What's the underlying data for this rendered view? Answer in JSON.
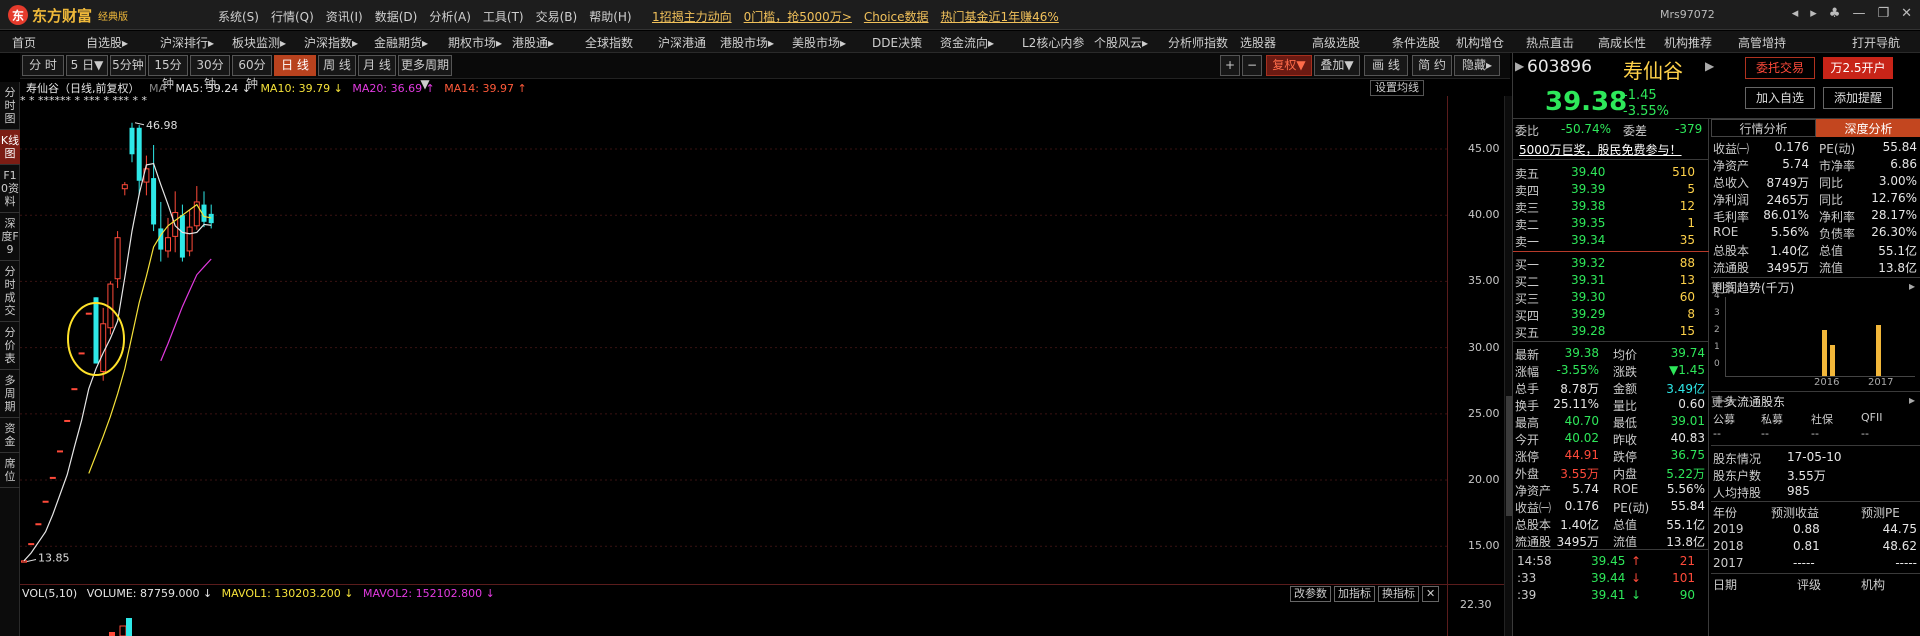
{
  "app": {
    "logo_name": "东方财富",
    "logo_edition": "经典版",
    "user": "Mrs97072"
  },
  "menu": [
    "系统(S)",
    "行情(Q)",
    "资讯(I)",
    "数据(D)",
    "分析(A)",
    "工具(T)",
    "交易(B)",
    "帮助(H)"
  ],
  "ads": [
    "1招揭主力动向",
    "0门槛，抢5000万>",
    "Choice数据",
    "热门基金近1年赚46%"
  ],
  "nav": [
    "首页",
    "自选股▸",
    "沪深排行▸",
    "板块监测▸",
    "沪深指数▸",
    "金融期货▸",
    "期权市场▸",
    "港股通▸",
    "全球指数",
    "沪深港通",
    "港股市场▸",
    "美股市场▸",
    "DDE决策",
    "资金流向▸",
    "L2核心内参",
    "个股风云▸",
    "分析师指数",
    "选股器",
    "高级选股",
    "条件选股",
    "机构增仓",
    "热点直击",
    "高成长性",
    "机构推荐",
    "高管增持",
    "打开导航"
  ],
  "left_tabs": [
    "分时图",
    "K线图",
    "F10资料",
    "深度F9",
    "分时成交",
    "分价表",
    "多周期",
    "资金",
    "席位"
  ],
  "toolbar_periods": [
    "分 时",
    "5 日▼",
    "5分钟",
    "15分钟",
    "30分钟",
    "60分钟",
    "日 线",
    "周 线",
    "月 线",
    "更多周期▼"
  ],
  "toolbar_right": [
    "+",
    "−",
    "复权▼",
    "叠加▼",
    "画 线",
    "简 约",
    "隐藏▸"
  ],
  "chart_header": {
    "name": "寿仙谷（日线,前复权）",
    "ma_label": "MA",
    "ma5": "MA5: 39.24 ↓",
    "ma10": "MA10: 39.79 ↓",
    "ma20": "MA20: 36.69 ↑",
    "ma14": "MA14: 39.97 ↑",
    "settings": "设置均线"
  },
  "stars": "*  *  ****** *  ***  *  ***  *  *",
  "chart_data": {
    "type": "candlestick",
    "ylim": [
      12,
      49
    ],
    "yticks": [
      "45.00",
      "40.00",
      "35.00",
      "30.00",
      "25.00",
      "20.00",
      "15.00"
    ],
    "annotations": [
      "46.98",
      "13.85"
    ],
    "candles": [
      {
        "o": 13.8,
        "c": 13.9,
        "h": 13.9,
        "l": 13.8
      },
      {
        "o": 15.2,
        "c": 15.2,
        "h": 15.2,
        "l": 15.2
      },
      {
        "o": 16.7,
        "c": 16.7,
        "h": 16.7,
        "l": 16.7
      },
      {
        "o": 18.4,
        "c": 18.4,
        "h": 18.4,
        "l": 18.4
      },
      {
        "o": 20.2,
        "c": 20.2,
        "h": 20.2,
        "l": 20.2
      },
      {
        "o": 22.2,
        "c": 22.2,
        "h": 22.2,
        "l": 22.2
      },
      {
        "o": 24.5,
        "c": 24.5,
        "h": 24.5,
        "l": 24.5
      },
      {
        "o": 26.9,
        "c": 26.9,
        "h": 26.9,
        "l": 26.9
      },
      {
        "o": 29.6,
        "c": 29.6,
        "h": 29.6,
        "l": 29.6
      },
      {
        "o": 32.6,
        "c": 32.6,
        "h": 32.6,
        "l": 32.6
      },
      {
        "o": 33.8,
        "c": 28.8,
        "h": 33.8,
        "l": 28.8
      },
      {
        "o": 28.2,
        "c": 31.8,
        "h": 33.0,
        "l": 27.5
      },
      {
        "o": 31.5,
        "c": 34.8,
        "h": 35.0,
        "l": 31.0
      },
      {
        "o": 35.2,
        "c": 38.3,
        "h": 38.8,
        "l": 34.5
      },
      {
        "o": 42.0,
        "c": 42.3,
        "h": 42.5,
        "l": 41.5
      },
      {
        "o": 46.6,
        "c": 44.6,
        "h": 46.98,
        "l": 44.0
      },
      {
        "o": 46.6,
        "c": 42.6,
        "h": 46.8,
        "l": 41.5
      },
      {
        "o": 42.5,
        "c": 43.5,
        "h": 44.5,
        "l": 41.5
      },
      {
        "o": 42.8,
        "c": 39.3,
        "h": 45.3,
        "l": 38.8
      },
      {
        "o": 39.0,
        "c": 37.4,
        "h": 41.0,
        "l": 36.5
      },
      {
        "o": 37.3,
        "c": 38.3,
        "h": 39.8,
        "l": 36.8
      },
      {
        "o": 38.4,
        "c": 40.2,
        "h": 41.8,
        "l": 37.2
      },
      {
        "o": 40.0,
        "c": 36.8,
        "h": 40.8,
        "l": 36.5
      },
      {
        "o": 37.3,
        "c": 39.1,
        "h": 40.4,
        "l": 36.9
      },
      {
        "o": 39.2,
        "c": 41.0,
        "h": 42.2,
        "l": 38.9
      },
      {
        "o": 40.8,
        "c": 39.5,
        "h": 41.8,
        "l": 39.1
      },
      {
        "o": 40.1,
        "c": 39.4,
        "h": 40.8,
        "l": 39.0
      }
    ],
    "ma5": [
      13.9,
      14.5,
      15.3,
      16.1,
      17.4,
      18.9,
      20.4,
      22.5,
      24.5,
      26.9,
      28.4,
      29.6,
      30.7,
      32.0,
      35.3,
      38.8,
      41.6,
      43.8,
      43.9,
      42.3,
      40.8,
      39.2,
      38.7,
      38.6,
      38.7,
      39.3,
      39.24
    ],
    "ma10": [
      null,
      null,
      null,
      null,
      null,
      null,
      null,
      null,
      null,
      20.5,
      21.9,
      23.3,
      24.8,
      26.5,
      28.4,
      30.9,
      33.4,
      35.4,
      37.6,
      38.5,
      39.2,
      39.6,
      40.0,
      40.4,
      40.8,
      39.9,
      39.79
    ],
    "ma20": [
      null,
      null,
      null,
      null,
      null,
      null,
      null,
      null,
      null,
      null,
      null,
      null,
      null,
      null,
      null,
      null,
      null,
      null,
      null,
      29.0,
      30.3,
      31.7,
      33.1,
      34.3,
      35.5,
      36.1,
      36.69
    ]
  },
  "volume": {
    "info": "VOL(5,10)",
    "volume": "VOLUME: 87759.000 ↓",
    "mavol1": "MAVOL1: 130203.200 ↓",
    "mavol2": "MAVOL2: 152102.800 ↓",
    "axis": "22.30",
    "buttons": [
      "改参数",
      "加指标",
      "换指标",
      "✕"
    ]
  },
  "stock": {
    "code": "603896",
    "name": "寿仙谷",
    "price": "39.38",
    "change": "-1.45",
    "pct": "-3.55%"
  },
  "right_buttons": [
    "委托交易",
    "万2.5开户",
    "加入自选",
    "添加提醒"
  ],
  "quote": {
    "weibi_label": "委比",
    "weibi": "-50.74%",
    "weicha_label": "委差",
    "weicha": "-379",
    "ad": "5000万巨奖，股民免费参与！",
    "sells": [
      {
        "l": "卖五",
        "p": "39.40",
        "v": "510"
      },
      {
        "l": "卖四",
        "p": "39.39",
        "v": "5"
      },
      {
        "l": "卖三",
        "p": "39.38",
        "v": "12"
      },
      {
        "l": "卖二",
        "p": "39.35",
        "v": "1"
      },
      {
        "l": "卖一",
        "p": "39.34",
        "v": "35"
      }
    ],
    "buys": [
      {
        "l": "买一",
        "p": "39.32",
        "v": "88"
      },
      {
        "l": "买二",
        "p": "39.31",
        "v": "13"
      },
      {
        "l": "买三",
        "p": "39.30",
        "v": "60"
      },
      {
        "l": "买四",
        "p": "39.29",
        "v": "8"
      },
      {
        "l": "买五",
        "p": "39.28",
        "v": "15"
      }
    ],
    "stats": [
      {
        "a": "最新",
        "av": "39.38",
        "ac": "green",
        "b": "均价",
        "bv": "39.74",
        "bc": "green"
      },
      {
        "a": "涨幅",
        "av": "-3.55%",
        "ac": "green",
        "b": "涨跌",
        "bv": "▼1.45",
        "bc": "green"
      },
      {
        "a": "总手",
        "av": "8.78万",
        "ac": "white",
        "b": "金额",
        "bv": "3.49亿",
        "bc": "cyan"
      },
      {
        "a": "换手",
        "av": "25.11%",
        "ac": "white",
        "b": "量比",
        "bv": "0.60",
        "bc": "white"
      },
      {
        "a": "最高",
        "av": "40.70",
        "ac": "green",
        "b": "最低",
        "bv": "39.01",
        "bc": "green"
      },
      {
        "a": "今开",
        "av": "40.02",
        "ac": "green",
        "b": "昨收",
        "bv": "40.83",
        "bc": "white"
      },
      {
        "a": "涨停",
        "av": "44.91",
        "ac": "red",
        "b": "跌停",
        "bv": "36.75",
        "bc": "green"
      },
      {
        "a": "外盘",
        "av": "3.55万",
        "ac": "red",
        "b": "内盘",
        "bv": "5.22万",
        "bc": "green"
      },
      {
        "a": "净资产",
        "av": "5.74",
        "ac": "white",
        "b": "ROE",
        "bv": "5.56%",
        "bc": "white"
      },
      {
        "a": "收益㈠",
        "av": "0.176",
        "ac": "white",
        "b": "PE(动)",
        "bv": "55.84",
        "bc": "white"
      },
      {
        "a": "总股本",
        "av": "1.40亿",
        "ac": "white",
        "b": "总值",
        "bv": "55.1亿",
        "bc": "white"
      },
      {
        "a": "流通股",
        "av": "3495万",
        "ac": "white",
        "b": "流值",
        "bv": "13.8亿",
        "bc": "white"
      }
    ],
    "ticks": [
      {
        "t": "14:58",
        "p": "39.45",
        "arrow": "↑",
        "v": "21",
        "c": "red"
      },
      {
        "t": ":33",
        "p": "39.44",
        "arrow": "↓",
        "v": "101",
        "c": "red"
      },
      {
        "t": ":39",
        "p": "39.41",
        "arrow": "↓",
        "v": "90",
        "c": "green"
      }
    ]
  },
  "deep": {
    "tabs": [
      "行情分析",
      "深度分析"
    ],
    "kv": [
      {
        "a": "收益㈠",
        "av": "0.176",
        "b": "PE(动)",
        "bv": "55.84"
      },
      {
        "a": "净资产",
        "av": "5.74",
        "b": "市净率",
        "bv": "6.86"
      },
      {
        "a": "总收入",
        "av": "8749万",
        "b": "同比",
        "bv": "3.00%"
      },
      {
        "a": "净利润",
        "av": "2465万",
        "b": "同比",
        "bv": "12.76%"
      },
      {
        "a": "毛利率",
        "av": "86.01%",
        "b": "净利率",
        "bv": "28.17%"
      },
      {
        "a": "ROE",
        "av": "5.56%",
        "b": "负债率",
        "bv": "26.30%"
      },
      {
        "a": "总股本",
        "av": "1.40亿",
        "b": "总值",
        "bv": "55.1亿"
      },
      {
        "a": "流通股",
        "av": "3495万",
        "b": "流值",
        "bv": "13.8亿"
      }
    ],
    "trend_title": "利润趋势(千万)",
    "more": "更多",
    "trend_yticks": [
      "4",
      "3",
      "2",
      "1",
      "0"
    ],
    "trend_years": [
      "2016",
      "2017"
    ],
    "trend_values": [
      2.7,
      1.8,
      3.0
    ],
    "holders_title": "十大流通股东",
    "holders_cols": [
      "公募",
      "私募",
      "社保",
      "QFII"
    ],
    "holders_vals": [
      "--",
      "--",
      "--",
      "--"
    ],
    "holder_info": [
      {
        "a": "股东情况",
        "v": "17-05-10"
      },
      {
        "a": "股东户数",
        "v": "3.55万"
      },
      {
        "a": "人均持股",
        "v": "985"
      }
    ],
    "forecast_cols": [
      "年份",
      "预测收益",
      "预测PE"
    ],
    "forecast": [
      {
        "y": "2019",
        "e": "0.88",
        "pe": "44.75"
      },
      {
        "y": "2018",
        "e": "0.81",
        "pe": "48.62"
      },
      {
        "y": "2017",
        "e": "-----",
        "pe": "-----"
      }
    ],
    "bottom": [
      "日期",
      "评级",
      "机构"
    ]
  }
}
